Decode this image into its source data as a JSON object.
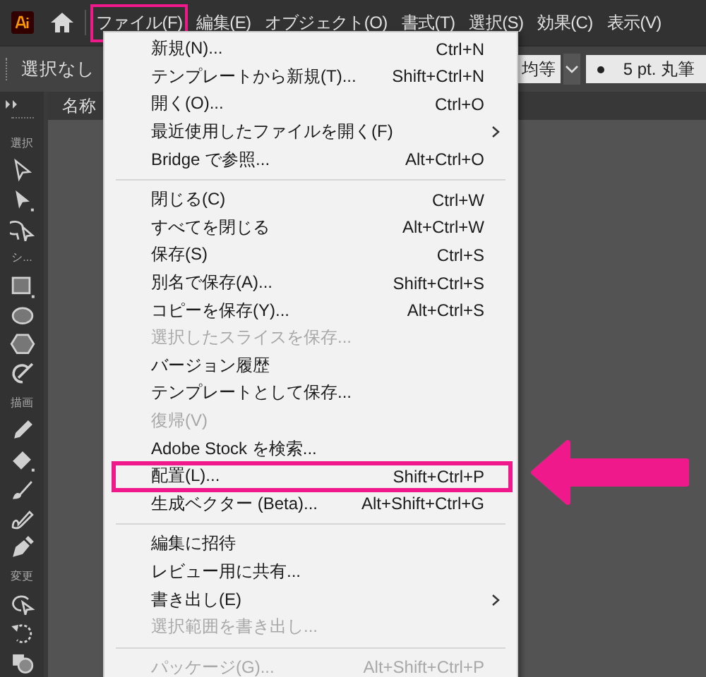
{
  "menubar": {
    "items": [
      {
        "label": "ファイル(F)",
        "selected": true
      },
      {
        "label": "編集(E)",
        "selected": false
      },
      {
        "label": "オブジェクト(O)",
        "selected": false
      },
      {
        "label": "書式(T)",
        "selected": false
      },
      {
        "label": "選択(S)",
        "selected": false
      },
      {
        "label": "効果(C)",
        "selected": false
      },
      {
        "label": "表示(V)",
        "selected": false
      }
    ]
  },
  "control_bar": {
    "selection": "選択なし",
    "profile": "均等",
    "brush": "5 pt. 丸筆"
  },
  "document_tab": {
    "title": "名称"
  },
  "toolbar": {
    "sections": [
      {
        "label": "選択"
      },
      {
        "label": "シ..."
      },
      {
        "label": "描画"
      },
      {
        "label": "変更"
      }
    ]
  },
  "file_menu": {
    "items": [
      {
        "kind": "item",
        "label": "新規(N)...",
        "shortcut": "Ctrl+N",
        "disabled": false,
        "submenu": false,
        "highlighted": false
      },
      {
        "kind": "item",
        "label": "テンプレートから新規(T)...",
        "shortcut": "Shift+Ctrl+N",
        "disabled": false,
        "submenu": false,
        "highlighted": false
      },
      {
        "kind": "item",
        "label": "開く(O)...",
        "shortcut": "Ctrl+O",
        "disabled": false,
        "submenu": false,
        "highlighted": false
      },
      {
        "kind": "item",
        "label": "最近使用したファイルを開く(F)",
        "disabled": false,
        "submenu": true,
        "highlighted": false
      },
      {
        "kind": "item",
        "label": "Bridge で参照...",
        "shortcut": "Alt+Ctrl+O",
        "disabled": false,
        "submenu": false,
        "highlighted": false
      },
      {
        "kind": "separator"
      },
      {
        "kind": "item",
        "label": "閉じる(C)",
        "shortcut": "Ctrl+W",
        "disabled": false,
        "submenu": false,
        "highlighted": false
      },
      {
        "kind": "item",
        "label": "すべてを閉じる",
        "shortcut": "Alt+Ctrl+W",
        "disabled": false,
        "submenu": false,
        "highlighted": false
      },
      {
        "kind": "item",
        "label": "保存(S)",
        "shortcut": "Ctrl+S",
        "disabled": false,
        "submenu": false,
        "highlighted": false
      },
      {
        "kind": "item",
        "label": "別名で保存(A)...",
        "shortcut": "Shift+Ctrl+S",
        "disabled": false,
        "submenu": false,
        "highlighted": false
      },
      {
        "kind": "item",
        "label": "コピーを保存(Y)...",
        "shortcut": "Alt+Ctrl+S",
        "disabled": false,
        "submenu": false,
        "highlighted": false
      },
      {
        "kind": "item",
        "label": "選択したスライスを保存...",
        "disabled": true,
        "submenu": false,
        "highlighted": false
      },
      {
        "kind": "item",
        "label": "バージョン履歴",
        "disabled": false,
        "submenu": false,
        "highlighted": false
      },
      {
        "kind": "item",
        "label": "テンプレートとして保存...",
        "disabled": false,
        "submenu": false,
        "highlighted": false
      },
      {
        "kind": "item",
        "label": "復帰(V)",
        "disabled": true,
        "submenu": false,
        "highlighted": false
      },
      {
        "kind": "item",
        "label": "Adobe Stock を検索...",
        "disabled": false,
        "submenu": false,
        "highlighted": false
      },
      {
        "kind": "item",
        "label": "配置(L)...",
        "shortcut": "Shift+Ctrl+P",
        "disabled": false,
        "submenu": false,
        "highlighted": true
      },
      {
        "kind": "item",
        "label": "生成ベクター (Beta)...",
        "shortcut": "Alt+Shift+Ctrl+G",
        "disabled": false,
        "submenu": false,
        "highlighted": false
      },
      {
        "kind": "separator"
      },
      {
        "kind": "item",
        "label": "編集に招待",
        "disabled": false,
        "submenu": false,
        "highlighted": false
      },
      {
        "kind": "item",
        "label": "レビュー用に共有...",
        "disabled": false,
        "submenu": false,
        "highlighted": false
      },
      {
        "kind": "item",
        "label": "書き出し(E)",
        "disabled": false,
        "submenu": true,
        "highlighted": false
      },
      {
        "kind": "item",
        "label": "選択範囲を書き出し...",
        "disabled": true,
        "submenu": false,
        "highlighted": false
      },
      {
        "kind": "separator"
      },
      {
        "kind": "item",
        "label": "パッケージ(G)...",
        "shortcut": "Alt+Shift+Ctrl+P",
        "disabled": true,
        "submenu": false,
        "highlighted": false
      }
    ]
  }
}
